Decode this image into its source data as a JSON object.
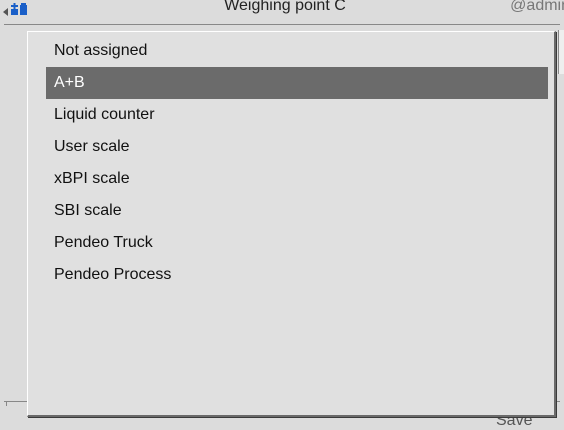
{
  "header": {
    "title": "Weighing point C",
    "user": "@admin",
    "back_icon": "back-arrow-icon",
    "logo_icon": "device-logo-icon"
  },
  "footer": {
    "save_label": "Save"
  },
  "dropdown": {
    "selected_index": 1,
    "options": [
      "Not assigned",
      "A+B",
      "Liquid counter",
      "User scale",
      "xBPI scale",
      "SBI scale",
      "Pendeo Truck",
      "Pendeo Process"
    ]
  },
  "colors": {
    "background": "#dcdcdc",
    "selected_row": "#6b6b6b",
    "selected_text": "#ffffff",
    "icon_blue": "#1a5fc8"
  }
}
